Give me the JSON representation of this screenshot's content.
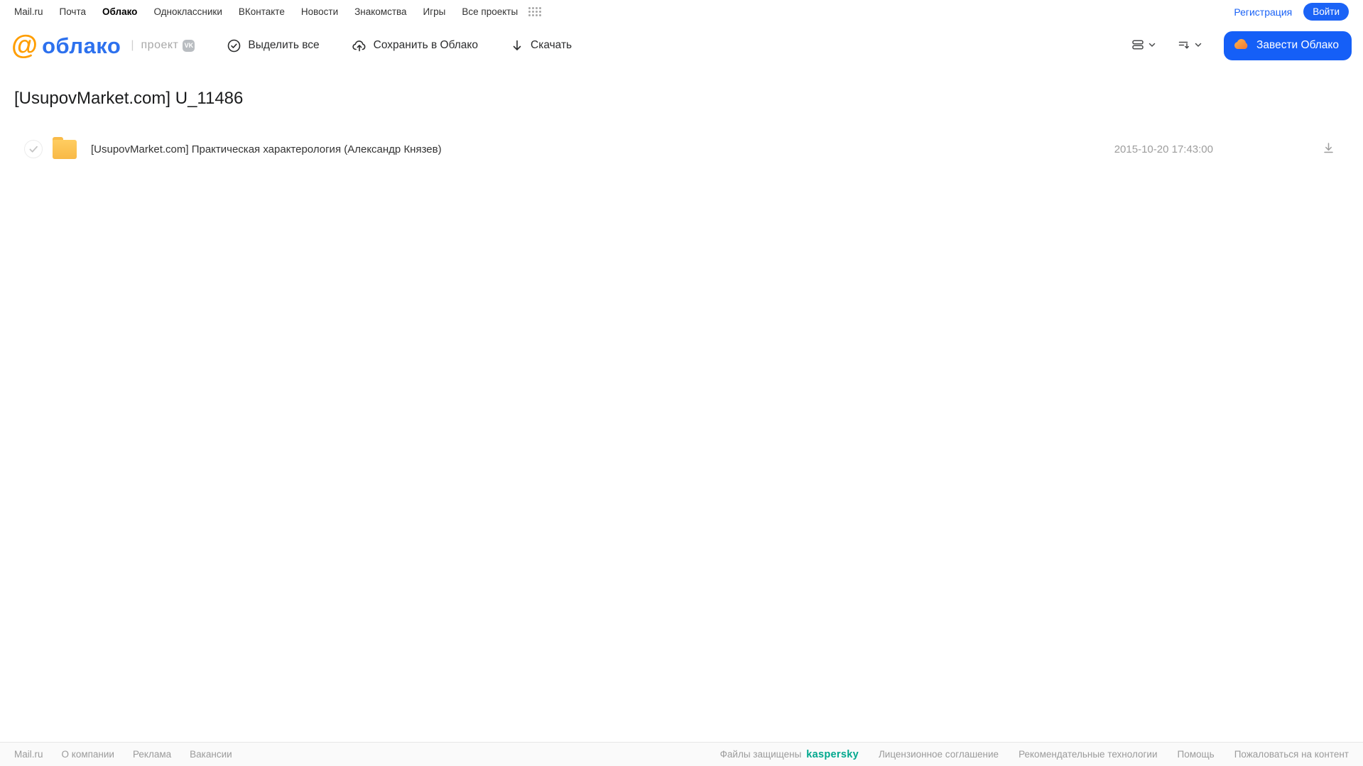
{
  "topbar": {
    "links": [
      "Mail.ru",
      "Почта",
      "Облако",
      "Одноклассники",
      "ВКонтакте",
      "Новости",
      "Знакомства",
      "Игры",
      "Все проекты"
    ],
    "active_link": "Облако",
    "register_label": "Регистрация",
    "login_label": "Войти"
  },
  "header": {
    "logo_at": "@",
    "logo_text": "облако",
    "project_separator": "|",
    "project_label": "проект",
    "vk_badge": "VK",
    "actions": [
      {
        "label": "Выделить все",
        "icon": "check-circle-icon"
      },
      {
        "label": "Сохранить в Облако",
        "icon": "cloud-upload-icon"
      },
      {
        "label": "Скачать",
        "icon": "download-icon"
      }
    ],
    "view_controls": [
      {
        "icon": "list-view-icon"
      },
      {
        "icon": "sort-icon"
      }
    ],
    "create_cloud_label": "Завести Облако"
  },
  "main": {
    "title": "[UsupovMarket.com] U_11486",
    "files": [
      {
        "type": "folder",
        "name": "[UsupovMarket.com] Практическая характерология (Александр Князев)",
        "date": "2015-10-20 17:43:00"
      }
    ]
  },
  "footer": {
    "left_links": [
      "Mail.ru",
      "О компании",
      "Реклама",
      "Вакансии"
    ],
    "protected_text": "Файлы защищены",
    "kaspersky_label": "kaspersky",
    "right_links": [
      "Лицензионное соглашение",
      "Рекомендательные технологии",
      "Помощь",
      "Пожаловаться на контент"
    ]
  },
  "colors": {
    "accent_blue": "#155ff7",
    "link_blue": "#1b63f6",
    "logo_orange": "#ff9e00",
    "logo_blue": "#2d71ee",
    "folder_amber": "#f8b947",
    "kaspersky_green": "#00a88e"
  }
}
